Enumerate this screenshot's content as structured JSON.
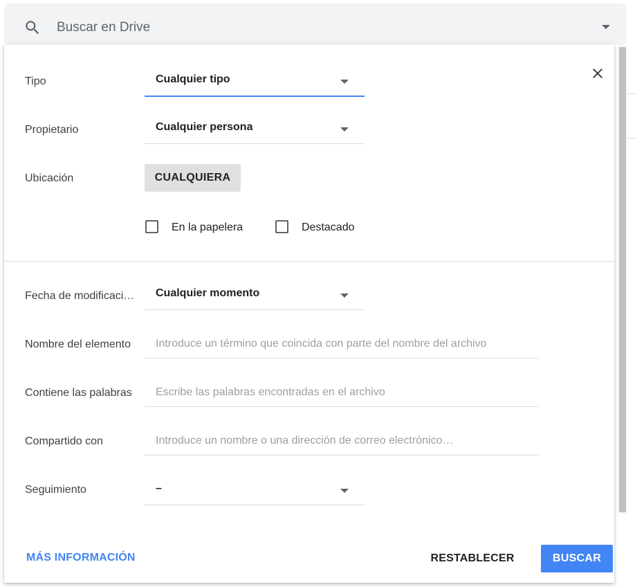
{
  "search": {
    "placeholder": "Buscar en Drive"
  },
  "panel": {
    "type": {
      "label": "Tipo",
      "value": "Cualquier tipo"
    },
    "owner": {
      "label": "Propietario",
      "value": "Cualquier persona"
    },
    "location": {
      "label": "Ubicación",
      "button": "CUALQUIERA"
    },
    "checkboxes": [
      {
        "label": "En la papelera",
        "checked": false
      },
      {
        "label": "Destacado",
        "checked": false
      }
    ],
    "modified": {
      "label": "Fecha de modificación",
      "value": "Cualquier momento"
    },
    "item_name": {
      "label": "Nombre del elemento",
      "placeholder": "Introduce un término que coincida con parte del nombre del archivo"
    },
    "contains": {
      "label": "Contiene las palabras",
      "placeholder": "Escribe las palabras encontradas en el archivo"
    },
    "shared": {
      "label": "Compartido con",
      "placeholder": "Introduce un nombre o una dirección de correo electrónico…"
    },
    "follow_up": {
      "label": "Seguimiento",
      "value": "–"
    },
    "footer": {
      "more_info": "MÁS INFORMACIÓN",
      "reset": "RESTABLECER",
      "search": "BUSCAR"
    }
  },
  "colors": {
    "accent": "#4285f4",
    "button_bg": "#e0e0e0",
    "searchbar_bg": "#f1f3f4"
  },
  "icons": {
    "search": "search-icon",
    "close": "close-icon",
    "caret": "arrow-drop-down-icon"
  }
}
